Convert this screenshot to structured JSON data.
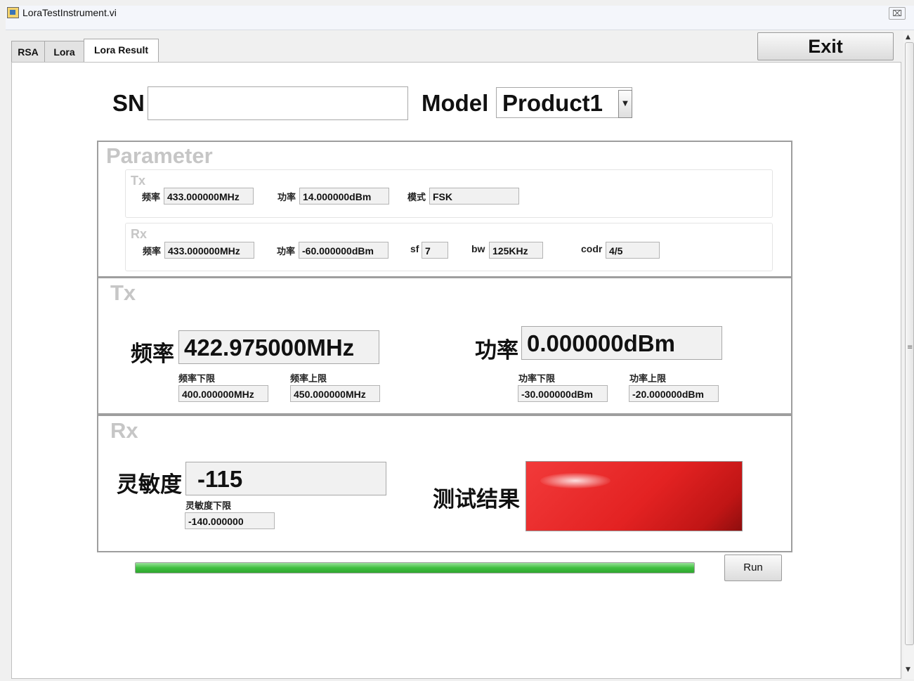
{
  "window": {
    "title": "LoraTestInstrument.vi",
    "close_glyph": "⌧"
  },
  "tabs": [
    {
      "label": "RSA"
    },
    {
      "label": "Lora"
    },
    {
      "label": "Lora Result",
      "active": true
    }
  ],
  "exit_label": "Exit",
  "header": {
    "sn_label": "SN",
    "sn_value": "",
    "model_label": "Model",
    "model_value": "Product1"
  },
  "parameter": {
    "title": "Parameter",
    "tx": {
      "title": "Tx",
      "freq_label": "频率",
      "freq_value": "433.000000MHz",
      "power_label": "功率",
      "power_value": "14.000000dBm",
      "mode_label": "模式",
      "mode_value": "FSK"
    },
    "rx": {
      "title": "Rx",
      "freq_label": "频率",
      "freq_value": "433.000000MHz",
      "power_label": "功率",
      "power_value": "-60.000000dBm",
      "sf_label": "sf",
      "sf_value": "7",
      "bw_label": "bw",
      "bw_value": "125KHz",
      "codr_label": "codr",
      "codr_value": "4/5"
    }
  },
  "tx_result": {
    "title": "Tx",
    "freq_label": "频率",
    "freq_value": "422.975000MHz",
    "freq_low_label": "频率下限",
    "freq_low_value": "400.000000MHz",
    "freq_high_label": "频率上限",
    "freq_high_value": "450.000000MHz",
    "power_label": "功率",
    "power_value": "0.000000dBm",
    "power_low_label": "功率下限",
    "power_low_value": "-30.000000dBm",
    "power_high_label": "功率上限",
    "power_high_value": "-20.000000dBm"
  },
  "rx_result": {
    "title": "Rx",
    "sens_label": "灵敏度",
    "sens_value": "-115",
    "sens_low_label": "灵敏度下限",
    "sens_low_value": "-140.000000",
    "result_label": "测试结果",
    "result_color": "#e32222"
  },
  "progress": {
    "fraction": 1.0,
    "color": "#3fbf3f"
  },
  "run_label": "Run",
  "colors": {
    "accent_red": "#e32222",
    "progress_green": "#3fbf3f",
    "section_title": "#c6c6c6"
  }
}
